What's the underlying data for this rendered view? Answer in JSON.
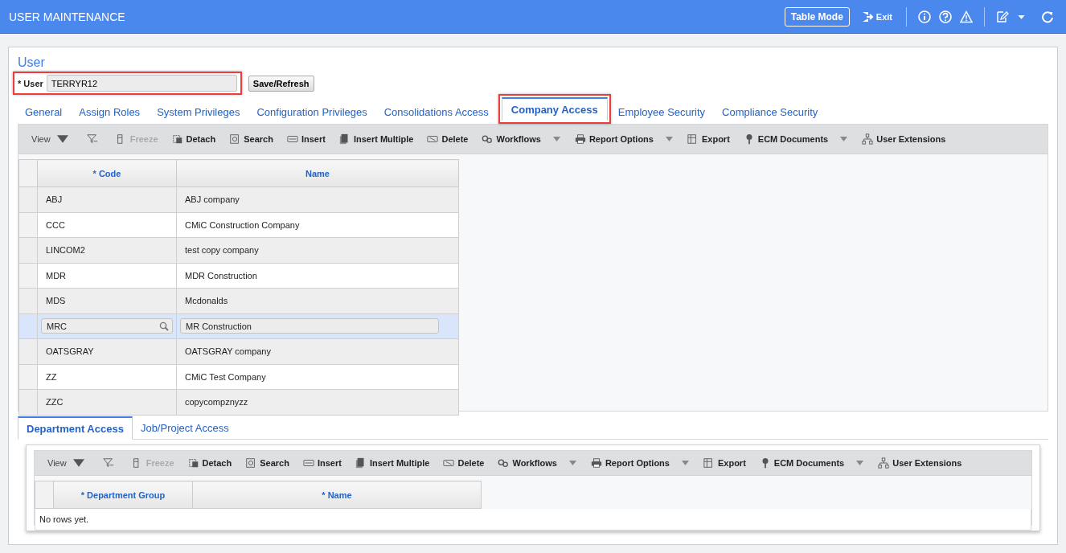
{
  "header": {
    "title": "USER MAINTENANCE",
    "table_mode": "Table Mode",
    "exit": "Exit"
  },
  "section_title": "User",
  "user_field": {
    "label": "* User",
    "value": "TERRYR12",
    "highlighted": true
  },
  "save_button": "Save/Refresh",
  "tabs": [
    {
      "label": "General",
      "selected": false,
      "highlighted": false
    },
    {
      "label": "Assign Roles",
      "selected": false,
      "highlighted": false
    },
    {
      "label": "System Privileges",
      "selected": false,
      "highlighted": false
    },
    {
      "label": "Configuration Privileges",
      "selected": false,
      "highlighted": false
    },
    {
      "label": "Consolidations Access",
      "selected": false,
      "highlighted": false
    },
    {
      "label": "Company Access",
      "selected": true,
      "highlighted": true
    },
    {
      "label": "Employee Security",
      "selected": false,
      "highlighted": false
    },
    {
      "label": "Compliance Security",
      "selected": false,
      "highlighted": false
    }
  ],
  "toolbar": [
    {
      "kind": "menu",
      "label": "View"
    },
    {
      "kind": "icon"
    },
    {
      "kind": "button",
      "label": "Freeze",
      "disabled": true,
      "dropdown": false
    },
    {
      "kind": "button",
      "label": "Detach",
      "disabled": false,
      "dropdown": false
    },
    {
      "kind": "button",
      "label": "Search",
      "disabled": false,
      "dropdown": false
    },
    {
      "kind": "button",
      "label": "Insert",
      "disabled": false,
      "dropdown": false
    },
    {
      "kind": "button",
      "label": "Insert Multiple",
      "disabled": false,
      "dropdown": false
    },
    {
      "kind": "button",
      "label": "Delete",
      "disabled": false,
      "dropdown": false
    },
    {
      "kind": "button",
      "label": "Workflows",
      "disabled": false,
      "dropdown": true
    },
    {
      "kind": "button",
      "label": "Report Options",
      "disabled": false,
      "dropdown": true
    },
    {
      "kind": "button",
      "label": "Export",
      "disabled": false,
      "dropdown": false
    },
    {
      "kind": "button",
      "label": "ECM Documents",
      "disabled": false,
      "dropdown": true
    },
    {
      "kind": "button",
      "label": "User Extensions",
      "disabled": false,
      "dropdown": false
    }
  ],
  "table": {
    "columns": [
      "* Code",
      "Name"
    ],
    "rows": [
      {
        "code": "ABJ",
        "name": "ABJ company",
        "selected": false
      },
      {
        "code": "CCC",
        "name": "CMiC Construction Company",
        "selected": false
      },
      {
        "code": "LINCOM2",
        "name": "test copy company",
        "selected": false
      },
      {
        "code": "MDR",
        "name": "MDR Construction",
        "selected": false
      },
      {
        "code": "MDS",
        "name": "Mcdonalds",
        "selected": false
      },
      {
        "code": "MRC",
        "name": "MR Construction",
        "selected": true
      },
      {
        "code": "OATSGRAY",
        "name": "OATSGRAY company",
        "selected": false
      },
      {
        "code": "ZZ",
        "name": "CMiC Test Company",
        "selected": false
      },
      {
        "code": "ZZC",
        "name": "copycompznyzz",
        "selected": false
      }
    ]
  },
  "sub_tabs": [
    {
      "label": "Department Access",
      "selected": true
    },
    {
      "label": "Job/Project Access",
      "selected": false
    }
  ],
  "sub_toolbar": [
    {
      "kind": "menu",
      "label": "View"
    },
    {
      "kind": "icon"
    },
    {
      "kind": "button",
      "label": "Freeze",
      "disabled": true,
      "dropdown": false
    },
    {
      "kind": "button",
      "label": "Detach",
      "disabled": false,
      "dropdown": false
    },
    {
      "kind": "button",
      "label": "Search",
      "disabled": false,
      "dropdown": false
    },
    {
      "kind": "button",
      "label": "Insert",
      "disabled": false,
      "dropdown": false
    },
    {
      "kind": "button",
      "label": "Insert Multiple",
      "disabled": false,
      "dropdown": false
    },
    {
      "kind": "button",
      "label": "Delete",
      "disabled": false,
      "dropdown": false
    },
    {
      "kind": "button",
      "label": "Workflows",
      "disabled": false,
      "dropdown": true
    },
    {
      "kind": "button",
      "label": "Report Options",
      "disabled": false,
      "dropdown": true
    },
    {
      "kind": "button",
      "label": "Export",
      "disabled": false,
      "dropdown": false
    },
    {
      "kind": "button",
      "label": "ECM Documents",
      "disabled": false,
      "dropdown": true
    },
    {
      "kind": "button",
      "label": "User Extensions",
      "disabled": false,
      "dropdown": false
    }
  ],
  "sub_table": {
    "columns": [
      "* Department Group",
      "* Name"
    ],
    "empty_text": "No rows yet."
  }
}
